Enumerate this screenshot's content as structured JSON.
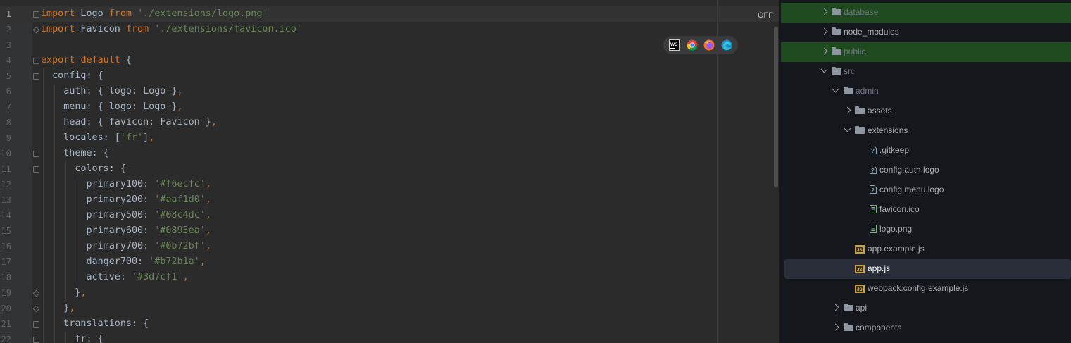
{
  "editor": {
    "off_label": "OFF",
    "lines": [
      {
        "num": "1",
        "tokens": [
          [
            "kw",
            "import"
          ],
          [
            "p",
            " Logo "
          ],
          [
            "kw",
            "from"
          ],
          [
            "p",
            " "
          ],
          [
            "str",
            "'./extensions/logo.png'"
          ]
        ]
      },
      {
        "num": "2",
        "tokens": [
          [
            "kw",
            "import"
          ],
          [
            "p",
            " Favicon "
          ],
          [
            "kw",
            "from"
          ],
          [
            "p",
            " "
          ],
          [
            "str",
            "'./extensions/favicon.ico'"
          ]
        ]
      },
      {
        "num": "3",
        "tokens": []
      },
      {
        "num": "4",
        "tokens": [
          [
            "kw",
            "export"
          ],
          [
            "p",
            " "
          ],
          [
            "kw",
            "default"
          ],
          [
            "p",
            " {"
          ]
        ]
      },
      {
        "num": "5",
        "tokens": [
          [
            "p",
            "  config: {"
          ]
        ]
      },
      {
        "num": "6",
        "tokens": [
          [
            "p",
            "    auth: { logo: Logo }"
          ],
          [
            "pn",
            ","
          ]
        ]
      },
      {
        "num": "7",
        "tokens": [
          [
            "p",
            "    menu: { logo: Logo }"
          ],
          [
            "pn",
            ","
          ]
        ]
      },
      {
        "num": "8",
        "tokens": [
          [
            "p",
            "    head: { favicon: Favicon }"
          ],
          [
            "pn",
            ","
          ]
        ]
      },
      {
        "num": "9",
        "tokens": [
          [
            "p",
            "    locales: ["
          ],
          [
            "str",
            "'fr'"
          ],
          [
            "p",
            "]"
          ],
          [
            "pn",
            ","
          ]
        ]
      },
      {
        "num": "10",
        "tokens": [
          [
            "p",
            "    theme: {"
          ]
        ]
      },
      {
        "num": "11",
        "tokens": [
          [
            "p",
            "      colors: {"
          ]
        ]
      },
      {
        "num": "12",
        "tokens": [
          [
            "p",
            "        primary100: "
          ],
          [
            "str",
            "'#f6ecfc'"
          ],
          [
            "pn",
            ","
          ]
        ]
      },
      {
        "num": "13",
        "tokens": [
          [
            "p",
            "        primary200: "
          ],
          [
            "str",
            "'#aaf1d0'"
          ],
          [
            "pn",
            ","
          ]
        ]
      },
      {
        "num": "14",
        "tokens": [
          [
            "p",
            "        primary500: "
          ],
          [
            "str",
            "'#08c4dc'"
          ],
          [
            "pn",
            ","
          ]
        ]
      },
      {
        "num": "15",
        "tokens": [
          [
            "p",
            "        primary600: "
          ],
          [
            "str",
            "'#0893ea'"
          ],
          [
            "pn",
            ","
          ]
        ]
      },
      {
        "num": "16",
        "tokens": [
          [
            "p",
            "        primary700: "
          ],
          [
            "str",
            "'#0b72bf'"
          ],
          [
            "pn",
            ","
          ]
        ]
      },
      {
        "num": "17",
        "tokens": [
          [
            "p",
            "        danger700: "
          ],
          [
            "str",
            "'#b72b1a'"
          ],
          [
            "pn",
            ","
          ]
        ]
      },
      {
        "num": "18",
        "tokens": [
          [
            "p",
            "        active: "
          ],
          [
            "str",
            "'#3d7cf1'"
          ],
          [
            "pn",
            ","
          ]
        ]
      },
      {
        "num": "19",
        "tokens": [
          [
            "p",
            "      }"
          ],
          [
            "pn",
            ","
          ]
        ]
      },
      {
        "num": "20",
        "tokens": [
          [
            "p",
            "    }"
          ],
          [
            "pn",
            ","
          ]
        ]
      },
      {
        "num": "21",
        "tokens": [
          [
            "p",
            "    translations: {"
          ]
        ]
      },
      {
        "num": "22",
        "tokens": [
          [
            "p",
            "      fr: {"
          ]
        ]
      }
    ],
    "browsers": [
      "webstorm-icon",
      "chrome-icon",
      "firefox-icon",
      "edge-icon"
    ]
  },
  "tree": {
    "items": [
      {
        "label": "database",
        "type": "folder",
        "state": "collapsed",
        "depth": 0,
        "style": "highlight"
      },
      {
        "label": "node_modules",
        "type": "folder",
        "state": "collapsed",
        "depth": 0,
        "style": "normal"
      },
      {
        "label": "public",
        "type": "folder",
        "state": "collapsed",
        "depth": 0,
        "style": "highlight"
      },
      {
        "label": "src",
        "type": "folder",
        "state": "expanded",
        "depth": 0,
        "style": "dim"
      },
      {
        "label": "admin",
        "type": "folder",
        "state": "expanded",
        "depth": 1,
        "style": "dim"
      },
      {
        "label": "assets",
        "type": "folder",
        "state": "collapsed",
        "depth": 2,
        "style": "normal"
      },
      {
        "label": "extensions",
        "type": "folder",
        "state": "expanded",
        "depth": 2,
        "style": "normal"
      },
      {
        "label": ".gitkeep",
        "type": "unknown-file",
        "depth": 3,
        "style": "normal"
      },
      {
        "label": "config.auth.logo",
        "type": "unknown-file",
        "depth": 3,
        "style": "normal"
      },
      {
        "label": "config.menu.logo",
        "type": "unknown-file",
        "depth": 3,
        "style": "normal"
      },
      {
        "label": "favicon.ico",
        "type": "image-file",
        "depth": 3,
        "style": "normal"
      },
      {
        "label": "logo.png",
        "type": "image-file",
        "depth": 3,
        "style": "normal"
      },
      {
        "label": "app.example.js",
        "type": "js-file",
        "depth": 2,
        "style": "normal"
      },
      {
        "label": "app.js",
        "type": "js-file",
        "depth": 2,
        "style": "selected"
      },
      {
        "label": "webpack.config.example.js",
        "type": "js-file",
        "depth": 2,
        "style": "normal"
      },
      {
        "label": "api",
        "type": "folder",
        "state": "collapsed",
        "depth": 1,
        "style": "normal"
      },
      {
        "label": "components",
        "type": "folder",
        "state": "collapsed",
        "depth": 1,
        "style": "normal"
      }
    ]
  },
  "colors": {
    "keyword": "#cc7832",
    "string": "#6a8759",
    "plain": "#a9b7c6",
    "highlight_row": "#1f4a1f",
    "selected_row": "#2a2e3b"
  }
}
